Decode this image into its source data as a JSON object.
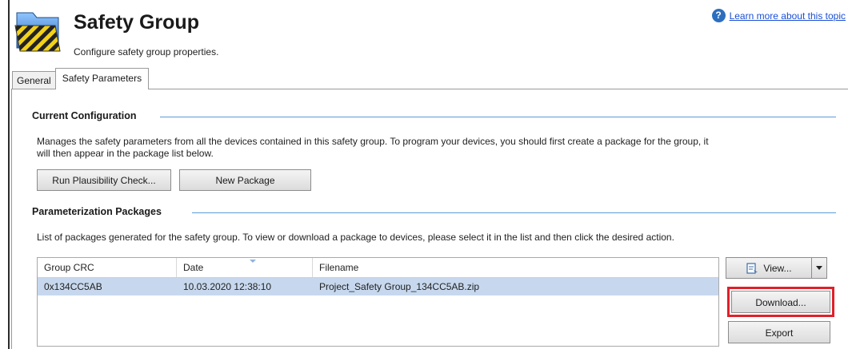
{
  "header": {
    "title": "Safety Group",
    "subtitle": "Configure safety group properties.",
    "help_link": "Learn more about this topic",
    "icon": "safety-group-folder-icon"
  },
  "tabs": [
    {
      "label": "General",
      "active": false
    },
    {
      "label": "Safety Parameters",
      "active": true
    }
  ],
  "current_configuration": {
    "heading": "Current Configuration",
    "description_line1": "Manages the safety parameters from all the devices contained in this safety group.  To program your devices, you should first create a package for the group, it",
    "description_line2": "will then appear in the package list below.",
    "buttons": {
      "plausibility": "Run Plausibility Check...",
      "new_package": "New Package"
    }
  },
  "packages": {
    "heading": "Parameterization Packages",
    "description": "List of packages generated for the safety group.  To view or download a package to devices, please select it in the list and then click the desired action.",
    "columns": [
      "Group CRC",
      "Date",
      "Filename"
    ],
    "rows": [
      {
        "crc": "0x134CC5AB",
        "date": "10.03.2020 12:38:10",
        "filename": "Project_Safety Group_134CC5AB.zip",
        "selected": true
      }
    ],
    "actions": {
      "view": "View...",
      "download": "Download...",
      "export": "Export"
    }
  },
  "colors": {
    "section_line": "#5b9bd5",
    "selected_row": "#c7d8ee",
    "highlight": "#e0202a",
    "link": "#1a4fd6"
  }
}
